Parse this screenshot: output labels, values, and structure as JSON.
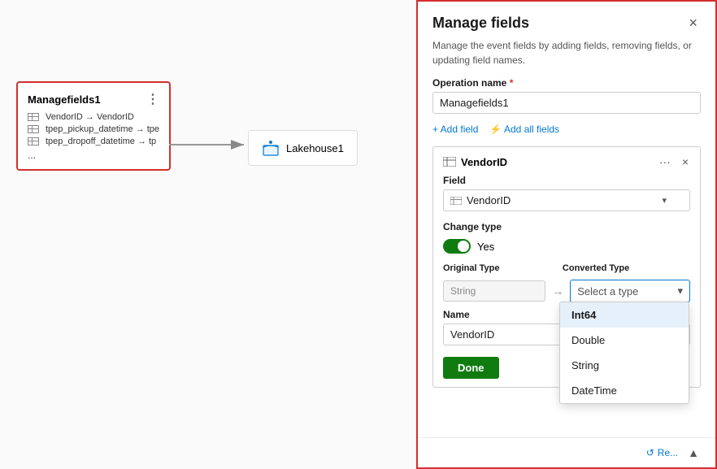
{
  "canvas": {
    "nodes": {
      "managefields": {
        "title": "Managefields1",
        "rows": [
          "VendorID → VendorID",
          "tpep_pickup_datetime → tpe",
          "tpep_dropoff_datetime → tp"
        ],
        "more": "..."
      },
      "lakehouse": {
        "title": "Lakehouse1"
      }
    }
  },
  "panel": {
    "title": "Manage fields",
    "subtitle": "Manage the event fields by adding fields, removing fields, or updating field names.",
    "close_label": "×",
    "operation_name_label": "Operation name",
    "operation_name_required": "*",
    "operation_name_value": "Managefields1",
    "add_field_label": "+ Add field",
    "add_all_fields_label": "⚡ Add all fields",
    "field_section": {
      "title": "VendorID",
      "ellipsis": "···",
      "close": "×",
      "field_label": "Field",
      "field_value": "VendorID",
      "change_type_label": "Change type",
      "toggle_state": "Yes",
      "original_type_label": "Original Type",
      "converted_type_label": "Converted Type",
      "original_type_value": "String",
      "converted_type_placeholder": "Select a type",
      "name_label": "Name",
      "name_value": "VendorID",
      "done_label": "Done"
    },
    "dropdown": {
      "options": [
        "Int64",
        "Double",
        "String",
        "DateTime"
      ]
    },
    "footer": {
      "refresh_label": "Re..."
    }
  }
}
